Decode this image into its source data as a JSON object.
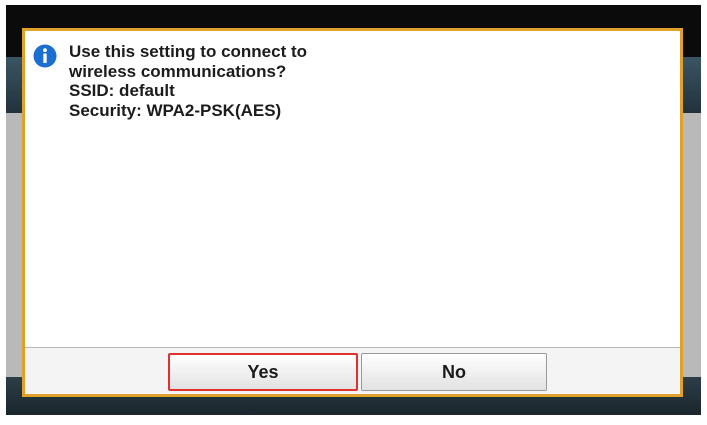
{
  "dialog": {
    "message_lines": [
      "Use this setting to connect to",
      "wireless communications?",
      "SSID: default",
      "Security: WPA2-PSK(AES)"
    ],
    "icon": "info-icon",
    "yes_label": "Yes",
    "no_label": "No"
  },
  "colors": {
    "dialog_border": "#e0a12a",
    "selected_button_outline": "#e03030",
    "info_icon": "#1a6fd1"
  }
}
